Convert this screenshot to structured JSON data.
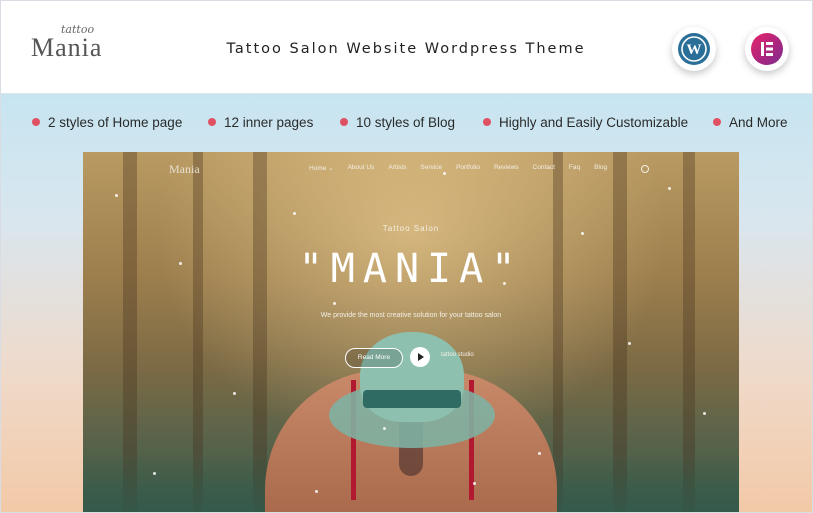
{
  "header": {
    "logo_script": "tattoo",
    "logo_word": "Mania",
    "title": "Tattoo Salon Website Wordpress Theme",
    "badges": [
      {
        "name": "wordpress-icon",
        "glyph": "W",
        "color": "#2a6f97"
      },
      {
        "name": "elementor-icon",
        "glyph": "E",
        "color": "#b0216d"
      }
    ]
  },
  "features": [
    "2 styles of Home page",
    "12 inner pages",
    "10 styles of Blog",
    "Highly and Easily Customizable",
    "And More"
  ],
  "preview": {
    "brand": "Mania",
    "nav_links": [
      "Home ⌄",
      "About Us",
      "Artists",
      "Service",
      "Portfolio",
      "Reviews",
      "Contact",
      "Faq",
      "Blog"
    ],
    "subtitle": "Tattoo Salon",
    "hero_title": "\"MANIA\"",
    "tagline": "We provide the most creative solution for your tattoo salon",
    "read_more": "Read More",
    "play_label": "tattoo studio"
  },
  "colors": {
    "accent_dot": "#e05263",
    "background_top": "#bfe3f2",
    "background_bottom": "#f2c9a7"
  }
}
